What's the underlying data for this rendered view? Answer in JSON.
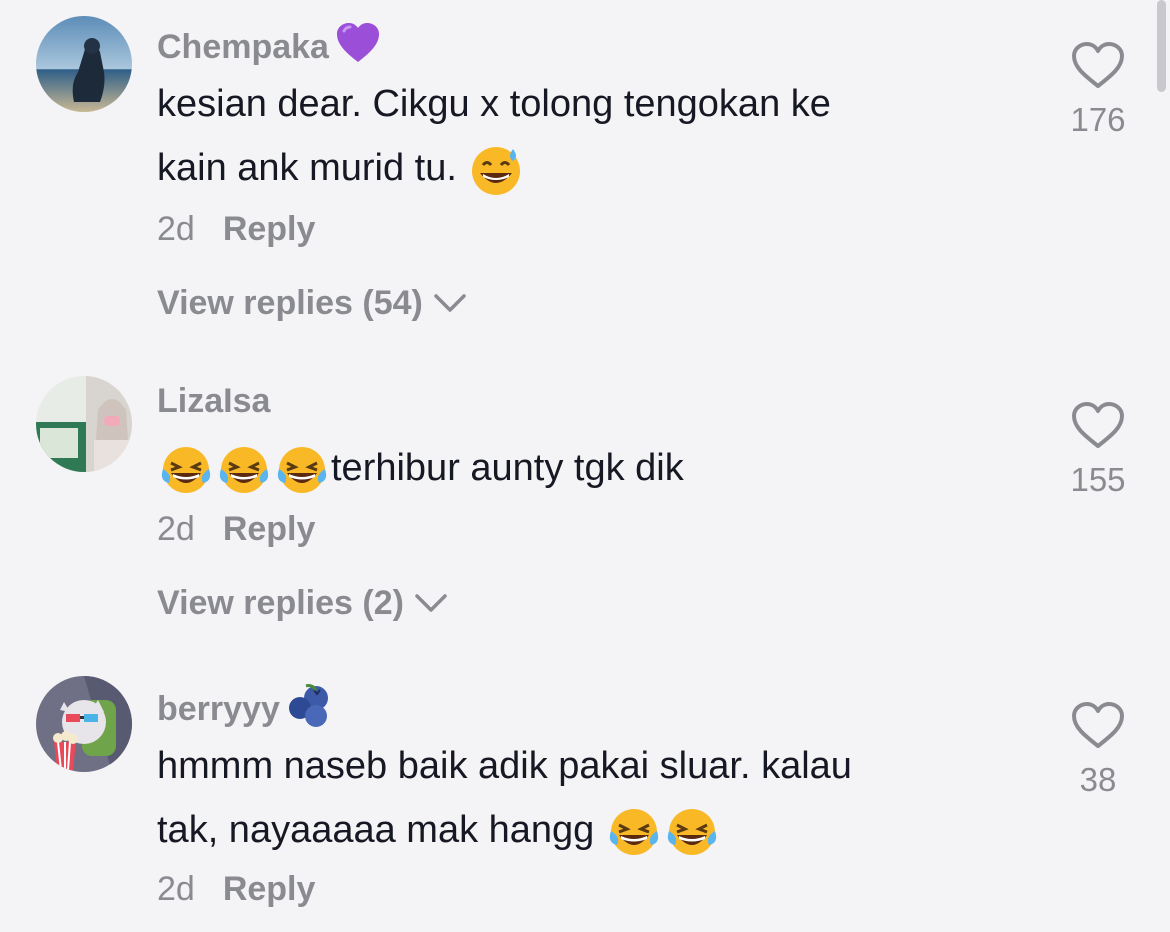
{
  "comments": [
    {
      "username": "Chempaka",
      "username_emoji": "purple-heart",
      "text_line1": "kesian dear. Cikgu x tolong tengokan ke",
      "text_line2": "kain ank murid tu.",
      "text_emojis": [
        "grinning-sweat-face"
      ],
      "time": "2d",
      "reply_label": "Reply",
      "view_replies": "View replies (54)",
      "likes": "176"
    },
    {
      "username": "LizaIsa",
      "text": "terhibur aunty tgk dik",
      "text_emojis": [
        "tears-of-joy-face",
        "tears-of-joy-face",
        "tears-of-joy-face"
      ],
      "time": "2d",
      "reply_label": "Reply",
      "view_replies": "View replies (2)",
      "likes": "155"
    },
    {
      "username": "berryyy",
      "username_emoji": "blueberries",
      "text_line1": "hmmm naseb baik adik pakai sluar. kalau",
      "text_line2": "tak, nayaaaaa mak hangg",
      "text_emojis": [
        "tears-of-joy-face",
        "tears-of-joy-face"
      ],
      "time": "2d",
      "reply_label": "Reply",
      "likes": "38"
    }
  ],
  "colors": {
    "background": "#f4f3f5",
    "primary_text": "#161823",
    "secondary_text": "#8a8b91"
  }
}
